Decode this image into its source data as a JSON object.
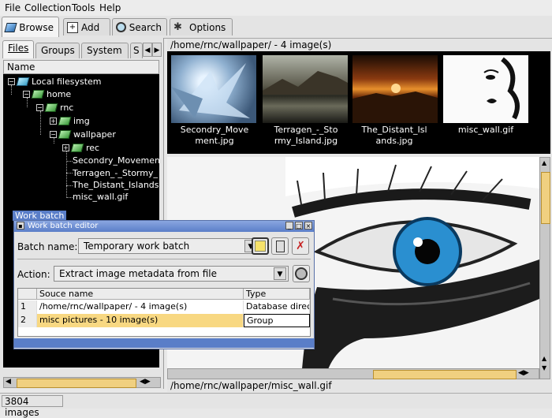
{
  "menu": [
    "File",
    "Collection",
    "Tools",
    "Help"
  ],
  "toolbar_tabs": [
    "Browse",
    "Add",
    "Search",
    "Options"
  ],
  "left_tabs": [
    "Files",
    "Groups",
    "System",
    "S"
  ],
  "tree": {
    "header": "Name",
    "items": [
      "Local filesystem",
      "home",
      "rnc",
      "img",
      "wallpaper",
      "rec",
      "Secondry_Movement",
      "Terragen_-_Stormy_",
      "The_Distant_Islands",
      "misc_wall.gif"
    ]
  },
  "work_batch_label": "Work batch",
  "path_top": "/home/rnc/wallpaper/ - 4 image(s)",
  "thumbnails": [
    {
      "caption": "Secondry_Move\nment.jpg"
    },
    {
      "caption": "Terragen_-_Sto\nrmy_Island.jpg"
    },
    {
      "caption": "The_Distant_Isl\nands.jpg"
    },
    {
      "caption": "misc_wall.gif"
    }
  ],
  "path_bottom": "/home/rnc/wallpaper/misc_wall.gif",
  "status": {
    "count": "3804 images"
  },
  "dialog": {
    "title": "Work batch editor",
    "batch_name_label": "Batch name:",
    "batch_name_value": "Temporary work batch",
    "action_label": "Action:",
    "action_value": "Extract image metadata from file",
    "columns": [
      "Souce name",
      "Type"
    ],
    "rows": [
      {
        "num": "1",
        "source": "/home/rnc/wallpaper/ - 4 image(s)",
        "type": "Database direc"
      },
      {
        "num": "2",
        "source": "misc pictures - 10 image(s)",
        "type": "Group"
      }
    ]
  },
  "colors": {
    "selection": "#5a7ec8",
    "highlight_row": "#f8d882",
    "eye_iris": "#2a8fd0"
  }
}
